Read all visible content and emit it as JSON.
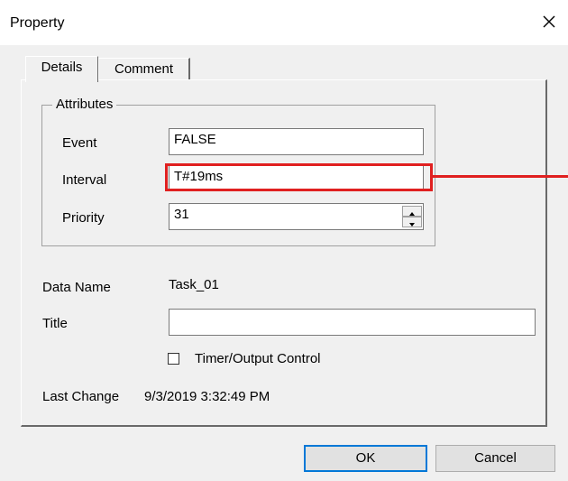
{
  "window": {
    "title": "Property",
    "close_icon": "close-icon"
  },
  "tabs": [
    {
      "label": "Details",
      "selected": true
    },
    {
      "label": "Comment",
      "selected": false
    }
  ],
  "attributes": {
    "group_label": "Attributes",
    "event": {
      "label": "Event",
      "value": "FALSE"
    },
    "interval": {
      "label": "Interval",
      "value": "T#19ms"
    },
    "priority": {
      "label": "Priority",
      "value": "31"
    }
  },
  "details": {
    "data_name_label": "Data Name",
    "data_name_value": "Task_01",
    "title_label": "Title",
    "title_value": "",
    "timer_output_label": "Timer/Output Control",
    "timer_output_checked": false,
    "last_change_label": "Last Change",
    "last_change_value": "9/3/2019 3:32:49 PM"
  },
  "buttons": {
    "ok": "OK",
    "cancel": "Cancel"
  },
  "colors": {
    "highlight": "#e02020",
    "focus": "#0078d7",
    "dialog_bg": "#f0f0f0"
  }
}
